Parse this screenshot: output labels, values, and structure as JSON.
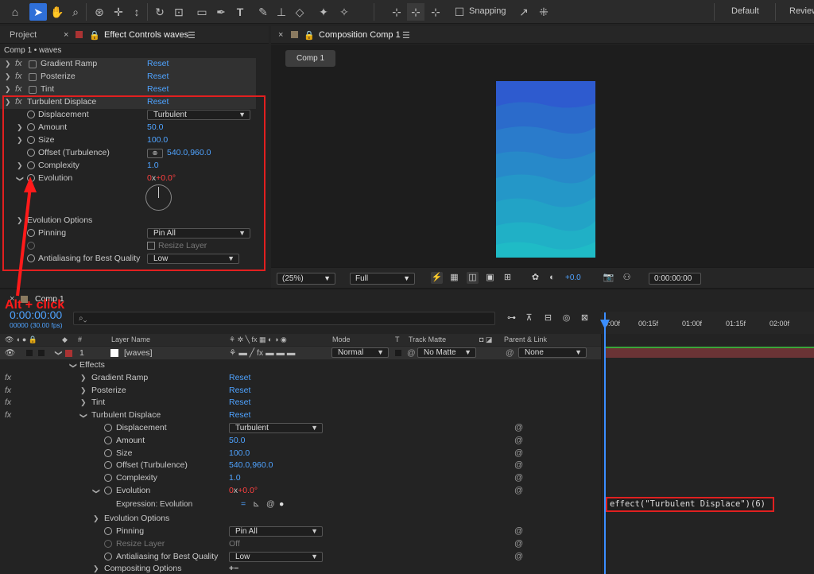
{
  "workspace": {
    "default_label": "Default",
    "review_label": "Review",
    "snapping_label": "Snapping"
  },
  "project_panel": {
    "tab_label": "Project",
    "effect_controls_tab": "Effect Controls waves",
    "breadcrumb": "Comp 1 • waves"
  },
  "effect_controls": {
    "rows": [
      {
        "name": "Gradient Ramp",
        "value": "Reset"
      },
      {
        "name": "Posterize",
        "value": "Reset"
      },
      {
        "name": "Tint",
        "value": "Reset"
      },
      {
        "name": "Turbulent Displace",
        "value": "Reset"
      },
      {
        "name": "Displacement",
        "value": "Turbulent"
      },
      {
        "name": "Amount",
        "value": "50.0"
      },
      {
        "name": "Size",
        "value": "100.0"
      },
      {
        "name": "Offset (Turbulence)",
        "value": "540.0,960.0"
      },
      {
        "name": "Complexity",
        "value": "1.0"
      },
      {
        "name": "Evolution",
        "value_rev": "0",
        "value_x": "x",
        "value_deg": "+0.0°"
      },
      {
        "name": "Evolution Options"
      },
      {
        "name": "Pinning",
        "value": "Pin All"
      },
      {
        "name": "Resize Layer"
      },
      {
        "name": "Antialiasing for Best Quality",
        "value": "Low"
      }
    ]
  },
  "composition_panel": {
    "tab_label": "Composition Comp 1",
    "comp_tab": "Comp 1"
  },
  "viewer_bar": {
    "zoom": "(25%)",
    "resolution": "Full",
    "exposure": "+0.0",
    "timecode": "0:00:00:00"
  },
  "annotation": {
    "label": "Alt + click"
  },
  "timeline": {
    "tab_label": "Comp 1",
    "timecode": "0:00:00:00",
    "fps": "00000 (30.00 fps)",
    "columns": {
      "num": "#",
      "layer_name": "Layer Name",
      "mode": "Mode",
      "t": "T",
      "track_matte": "Track Matte",
      "parent": "Parent & Link"
    },
    "layer": {
      "index": "1",
      "name": "[waves]",
      "mode": "Normal",
      "matte": "No Matte",
      "parent": "None"
    },
    "ruler_ticks": [
      "0:00f",
      "00:15f",
      "01:00f",
      "01:15f",
      "02:00f"
    ],
    "rows": [
      {
        "name": "Effects"
      },
      {
        "name": "Gradient Ramp",
        "value": "Reset"
      },
      {
        "name": "Posterize",
        "value": "Reset"
      },
      {
        "name": "Tint",
        "value": "Reset"
      },
      {
        "name": "Turbulent Displace",
        "value": "Reset"
      },
      {
        "name": "Displacement",
        "value": "Turbulent"
      },
      {
        "name": "Amount",
        "value": "50.0"
      },
      {
        "name": "Size",
        "value": "100.0"
      },
      {
        "name": "Offset (Turbulence)",
        "value": "540.0,960.0"
      },
      {
        "name": "Complexity",
        "value": "1.0"
      },
      {
        "name": "Evolution",
        "value_rev": "0",
        "value_x": "x",
        "value_deg": "+0.0°"
      },
      {
        "name": "Expression: Evolution"
      },
      {
        "name": "Evolution Options"
      },
      {
        "name": "Pinning",
        "value": "Pin All"
      },
      {
        "name": "Resize Layer",
        "value": "Off"
      },
      {
        "name": "Antialiasing for Best Quality",
        "value": "Low"
      },
      {
        "name": "Compositing Options",
        "value": "+−"
      }
    ],
    "expression": "effect(\"Turbulent Displace\")(6)"
  },
  "colors": {
    "accent": "#2f6fd8",
    "value_blue": "#4fa3ff",
    "annotation_red": "#e21f1f"
  }
}
